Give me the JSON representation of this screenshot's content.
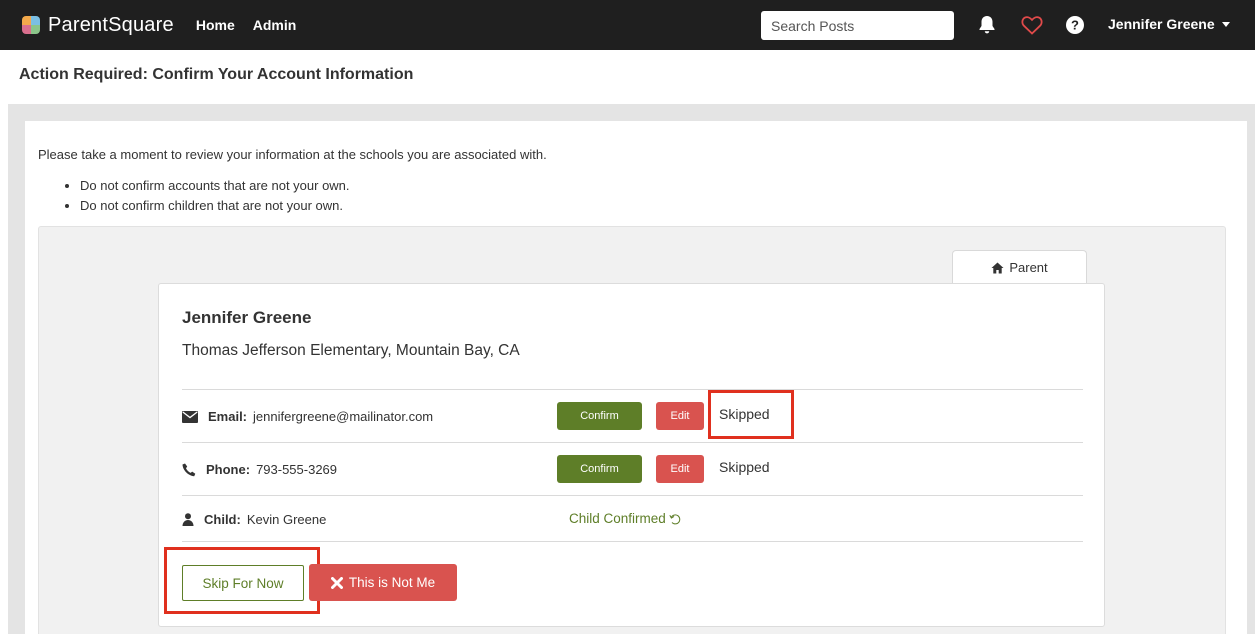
{
  "nav": {
    "brand": "ParentSquare",
    "links": [
      "Home",
      "Admin"
    ],
    "search_placeholder": "Search Posts",
    "user_name": "Jennifer Greene",
    "icons": [
      "bell-icon",
      "heart-icon",
      "help-icon",
      "chevron-down-icon"
    ]
  },
  "header": {
    "title": "Action Required: Confirm Your Account Information"
  },
  "intro": {
    "text": "Please take a moment to review your information at the schools you are associated with.",
    "bullets": [
      "Do not confirm accounts that are not your own.",
      "Do not confirm children that are not your own."
    ]
  },
  "tab": {
    "label": "Parent",
    "icon": "home-icon"
  },
  "card": {
    "name": "Jennifer Greene",
    "school": "Thomas Jefferson Elementary, Mountain Bay, CA",
    "rows": [
      {
        "icon": "envelope-icon",
        "label": "Email:",
        "value": "jennifergreene@mailinator.com",
        "confirm": "Confirm",
        "edit": "Edit",
        "status": "Skipped"
      },
      {
        "icon": "phone-icon",
        "label": "Phone:",
        "value": "793-555-3269",
        "confirm": "Confirm",
        "edit": "Edit",
        "status": "Skipped"
      },
      {
        "icon": "user-icon",
        "label": "Child:",
        "value": "Kevin Greene",
        "status": "Child Confirmed"
      }
    ]
  },
  "actions": {
    "skip": "Skip For Now",
    "not_me": "This is Not Me"
  },
  "colors": {
    "nav_bg": "#1f1f1f",
    "confirm_green": "#5e7e28",
    "danger_red": "#d9534f",
    "highlight_red": "#e0301e"
  }
}
